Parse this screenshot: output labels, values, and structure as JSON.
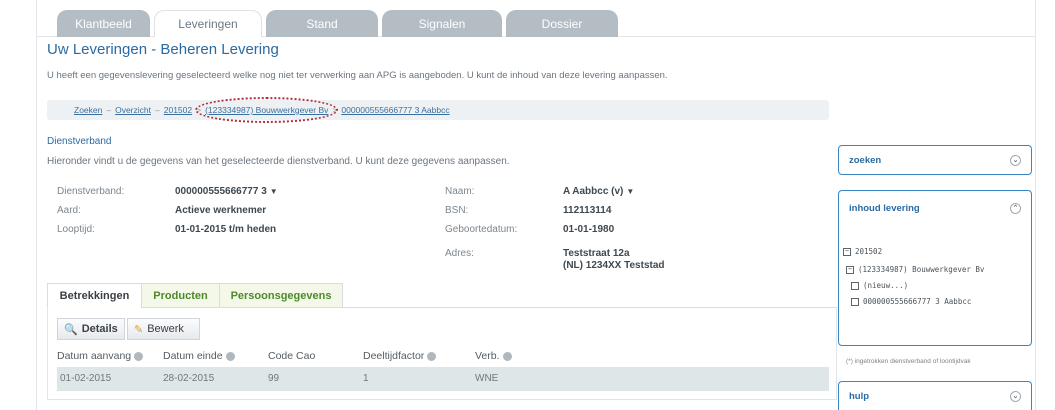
{
  "tabs": [
    {
      "label": "Klantbeeld"
    },
    {
      "label": "Leveringen"
    },
    {
      "label": "Stand"
    },
    {
      "label": "Signalen"
    },
    {
      "label": "Dossier"
    }
  ],
  "header": {
    "title": "Uw Leveringen - Beheren Levering",
    "intro": "U heeft een gegevenslevering geselecteerd welke nog niet ter verwerking aan APG is aangeboden. U kunt de inhoud van deze levering aanpassen."
  },
  "breadcrumb": {
    "items": [
      "Zoeken",
      "Overzicht",
      "201502",
      "(123334987) Bouwwerkgever Bv",
      "000000555666777 3 Aabbcc"
    ],
    "separator": "–",
    "arrow": ">"
  },
  "section": {
    "title": "Dienstverband",
    "subtitle": "Hieronder vindt u de gegevens van het geselecteerde dienstverband. U kunt deze gegevens aanpassen."
  },
  "details": {
    "dienstverband_label": "Dienstverband:",
    "dienstverband_value": "000000555666777 3",
    "aard_label": "Aard:",
    "aard_value": "Actieve werknemer",
    "looptijd_label": "Looptijd:",
    "looptijd_value": "01-01-2015 t/m heden",
    "naam_label": "Naam:",
    "naam_value": "A Aabbcc (v)",
    "bsn_label": "BSN:",
    "bsn_value": "112113114",
    "geboortedatum_label": "Geboortedatum:",
    "geboortedatum_value": "01-01-1980",
    "adres_label": "Adres:",
    "adres_line1": "Teststraat 12a",
    "adres_line2": "(NL) 1234XX Teststad"
  },
  "subtabs": [
    {
      "label": "Betrekkingen"
    },
    {
      "label": "Producten"
    },
    {
      "label": "Persoonsgegevens"
    }
  ],
  "toolbar": {
    "details_label": "Details",
    "bewerk_label": "Bewerk"
  },
  "table": {
    "columns": [
      "Datum aanvang",
      "Datum einde",
      "Code Cao",
      "Deeltijdfactor",
      "Verb."
    ],
    "rows": [
      [
        "01-02-2015",
        "28-02-2015",
        "99",
        "1",
        "WNE"
      ]
    ]
  },
  "sidebar": {
    "zoeken_title": "zoeken",
    "inhoud_title": "inhoud levering",
    "tree": {
      "root": "201502",
      "employer": "(123334987) Bouwwerkgever Bv",
      "new_item": "(nieuw...)",
      "employee": "000000555666777 3 Aabbcc"
    },
    "footnote": "(*) ingetrokken dienstverband of loontijdvak",
    "hulp_title": "hulp"
  },
  "colors": {
    "primary_blue": "#2a6aa3",
    "panel_border": "#3a86c2",
    "subtab_green": "#4d8a2a",
    "highlight_red": "#b02a3a"
  }
}
